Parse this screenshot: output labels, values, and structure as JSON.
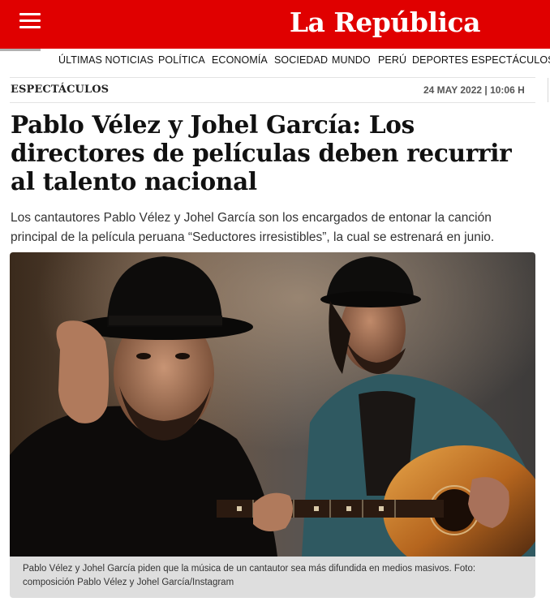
{
  "header": {
    "menu_icon": "hamburger-menu-icon",
    "logo_text": "La República",
    "brand_color": "#e00000"
  },
  "nav": {
    "items": [
      "ÚLTIMAS NOTICIAS",
      "POLÍTICA",
      "ECONOMÍA",
      "SOCIEDAD",
      "MUNDO",
      "PERÚ",
      "DEPORTES",
      "ESPECTÁCULOS"
    ]
  },
  "article": {
    "section": "ESPECTÁCULOS",
    "date": "24 MAY 2022 | 10:06 H",
    "headline": "Pablo Vélez y Johel García: Los directores de películas deben recurrir al talento nacional",
    "summary": "Los cantautores Pablo Vélez y Johel García son los encargados de entonar la canción principal de la película peruana “Seductores irresistibles”, la cual se estrenará en junio.",
    "caption": "Pablo Vélez y Johel García piden que la música de un cantautor sea más difundida en medios masivos. Foto: composición Pablo Vélez y Johel García/Instagram"
  }
}
